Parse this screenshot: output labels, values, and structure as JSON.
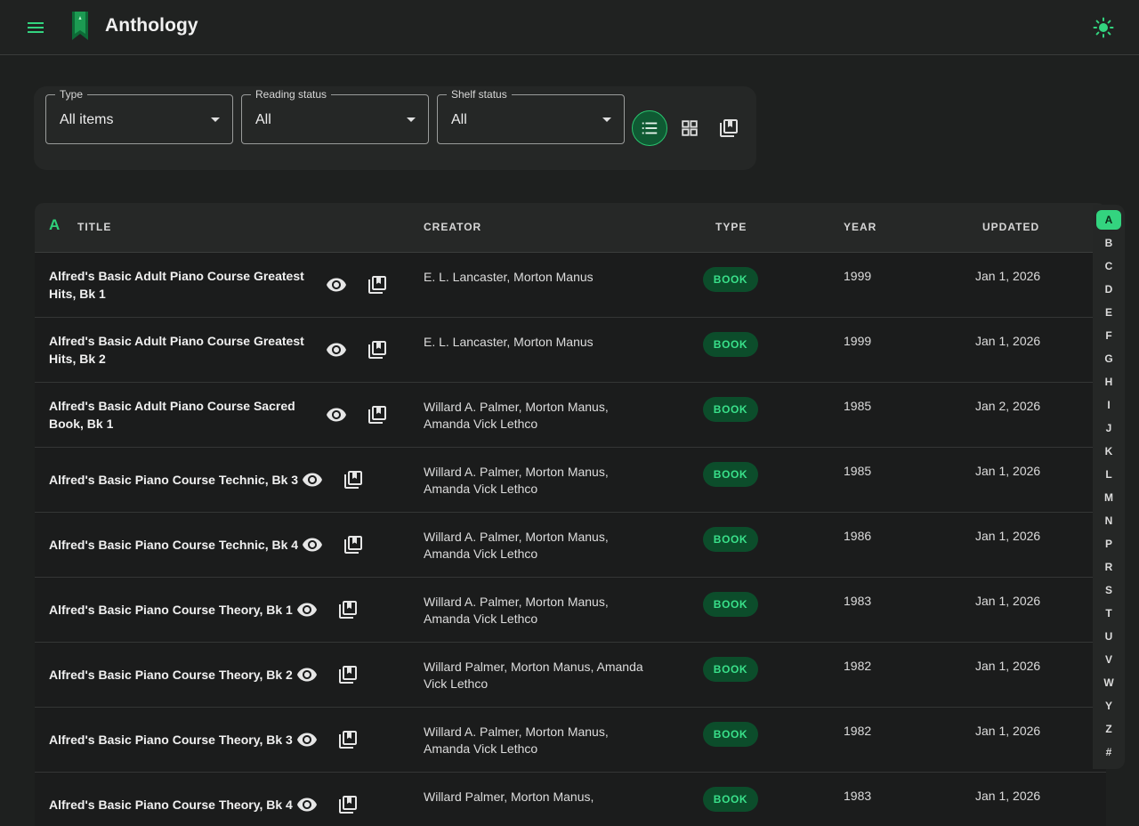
{
  "app": {
    "title": "Anthology"
  },
  "filters": {
    "type": {
      "label": "Type",
      "value": "All items"
    },
    "reading_status": {
      "label": "Reading status",
      "value": "All"
    },
    "shelf_status": {
      "label": "Shelf status",
      "value": "All"
    }
  },
  "table": {
    "sort_letter": "A",
    "headers": {
      "title": "TITLE",
      "creator": "CREATOR",
      "type": "TYPE",
      "year": "YEAR",
      "updated": "UPDATED"
    },
    "rows": [
      {
        "title": "Alfred's Basic Adult Piano Course Greatest Hits, Bk 1",
        "creator": "E. L. Lancaster, Morton Manus",
        "type": "BOOK",
        "year": "1999",
        "updated": "Jan 1, 2026"
      },
      {
        "title": "Alfred's Basic Adult Piano Course Greatest Hits, Bk 2",
        "creator": "E. L. Lancaster, Morton Manus",
        "type": "BOOK",
        "year": "1999",
        "updated": "Jan 1, 2026"
      },
      {
        "title": "Alfred's Basic Adult Piano Course Sacred Book, Bk 1",
        "creator": "Willard A. Palmer, Morton Manus, Amanda Vick Lethco",
        "type": "BOOK",
        "year": "1985",
        "updated": "Jan 2, 2026"
      },
      {
        "title": "Alfred's Basic Piano Course Technic, Bk 3",
        "creator": "Willard A. Palmer, Morton Manus, Amanda Vick Lethco",
        "type": "BOOK",
        "year": "1985",
        "updated": "Jan 1, 2026"
      },
      {
        "title": "Alfred's Basic Piano Course Technic, Bk 4",
        "creator": "Willard A. Palmer, Morton Manus, Amanda Vick Lethco",
        "type": "BOOK",
        "year": "1986",
        "updated": "Jan 1, 2026"
      },
      {
        "title": "Alfred's Basic Piano Course Theory, Bk 1",
        "creator": "Willard A. Palmer, Morton Manus, Amanda Vick Lethco",
        "type": "BOOK",
        "year": "1983",
        "updated": "Jan 1, 2026"
      },
      {
        "title": "Alfred's Basic Piano Course Theory, Bk 2",
        "creator": "Willard Palmer, Morton Manus, Amanda Vick Lethco",
        "type": "BOOK",
        "year": "1982",
        "updated": "Jan 1, 2026"
      },
      {
        "title": "Alfred's Basic Piano Course Theory, Bk 3",
        "creator": "Willard A. Palmer, Morton Manus, Amanda Vick Lethco",
        "type": "BOOK",
        "year": "1982",
        "updated": "Jan 1, 2026"
      },
      {
        "title": "Alfred's Basic Piano Course Theory, Bk 4",
        "creator": "Willard Palmer, Morton Manus,",
        "type": "BOOK",
        "year": "1983",
        "updated": "Jan 1, 2026"
      }
    ]
  },
  "alphabet": {
    "active": "A",
    "letters": [
      "A",
      "B",
      "C",
      "D",
      "E",
      "F",
      "G",
      "H",
      "I",
      "J",
      "K",
      "L",
      "M",
      "N",
      "P",
      "R",
      "S",
      "T",
      "U",
      "V",
      "W",
      "Y",
      "Z",
      "#"
    ]
  },
  "icons": {
    "menu": "menu-icon",
    "theme": "sun-icon",
    "list_view": "list-view-icon",
    "grid_view": "grid-view-icon",
    "shelf_view": "library-icon",
    "row_view": "eye-icon",
    "row_shelf": "library-icon"
  },
  "colors": {
    "accent": "#33d47f",
    "badge_bg": "#0c4d2b",
    "background": "#1e201f"
  }
}
